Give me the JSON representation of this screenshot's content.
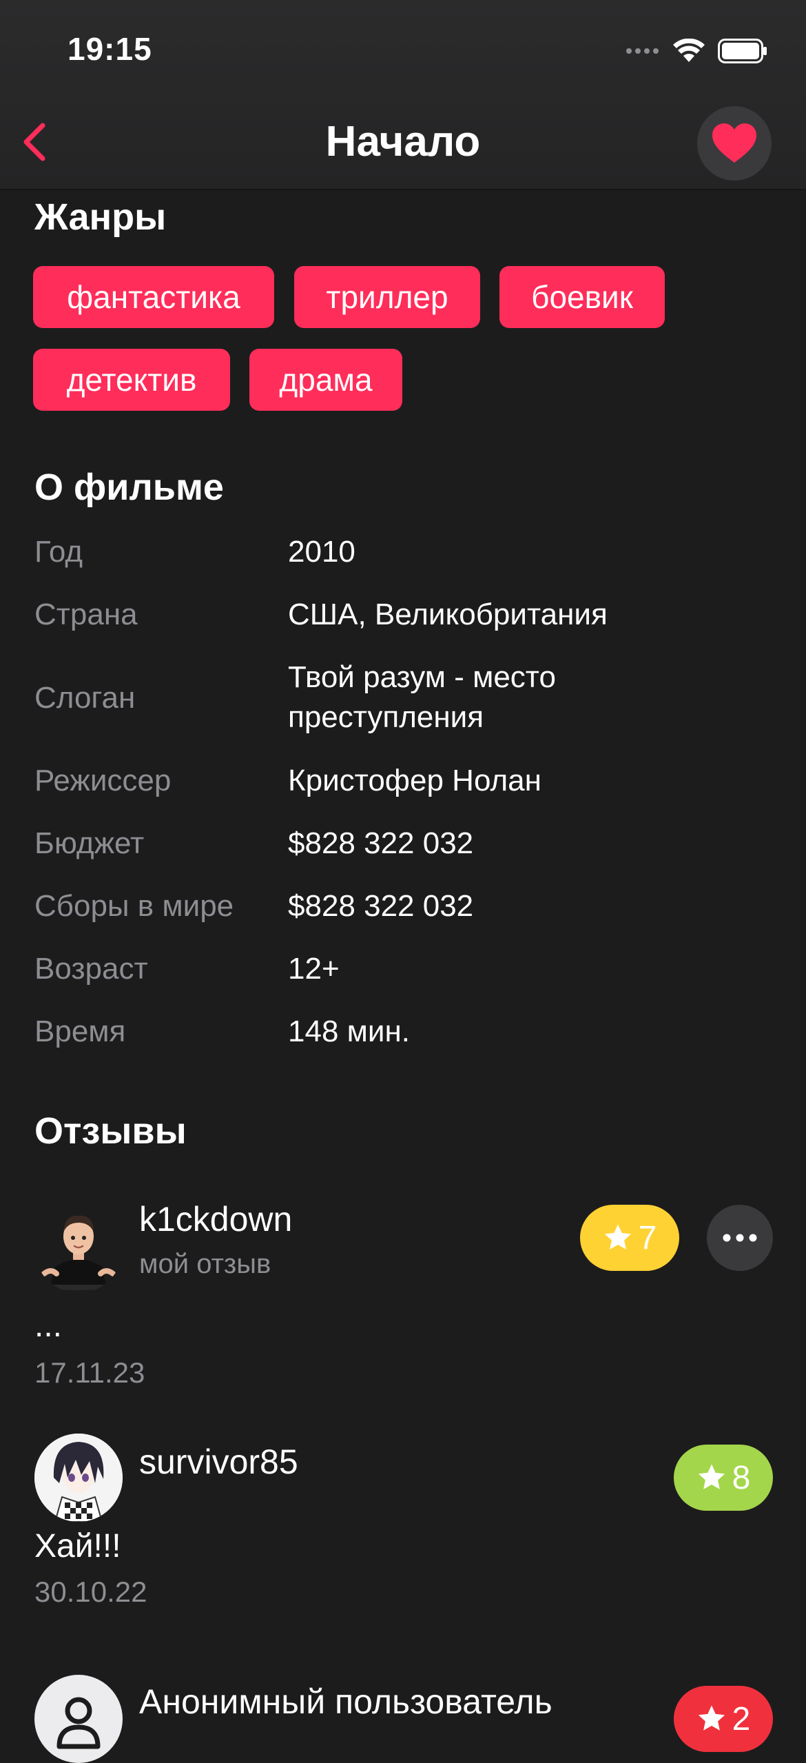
{
  "status": {
    "time": "19:15"
  },
  "nav": {
    "title": "Начало"
  },
  "genres": {
    "title": "Жанры",
    "items": [
      "фантастика",
      "триллер",
      "боевик",
      "детектив",
      "драма"
    ]
  },
  "about": {
    "title": "О фильме",
    "rows": [
      {
        "label": "Год",
        "value": "2010"
      },
      {
        "label": "Страна",
        "value": "США, Великобритания"
      },
      {
        "label": "Слоган",
        "value": "Твой разум - место преступления"
      },
      {
        "label": "Режиссер",
        "value": "Кристофер Нолан"
      },
      {
        "label": "Бюджет",
        "value": "$828 322 032"
      },
      {
        "label": "Сборы в мире",
        "value": "$828 322 032"
      },
      {
        "label": "Возраст",
        "value": "12+"
      },
      {
        "label": "Время",
        "value": "148 мин."
      }
    ]
  },
  "reviews": {
    "title": "Отзывы",
    "items": [
      {
        "author": "k1ckdown",
        "subtitle": "мой отзыв",
        "rating": "7",
        "rating_color": "#ffd233",
        "text": "...",
        "date": "17.11.23"
      },
      {
        "author": "survivor85",
        "rating": "8",
        "rating_color": "#a3d64a",
        "text": "Хай!!!",
        "date": "30.10.22"
      },
      {
        "author": "Анонимный пользователь",
        "rating": "2",
        "rating_color": "#f0313d"
      }
    ]
  },
  "colors": {
    "accent": "#ff2d5a",
    "background": "#1c1c1d"
  }
}
